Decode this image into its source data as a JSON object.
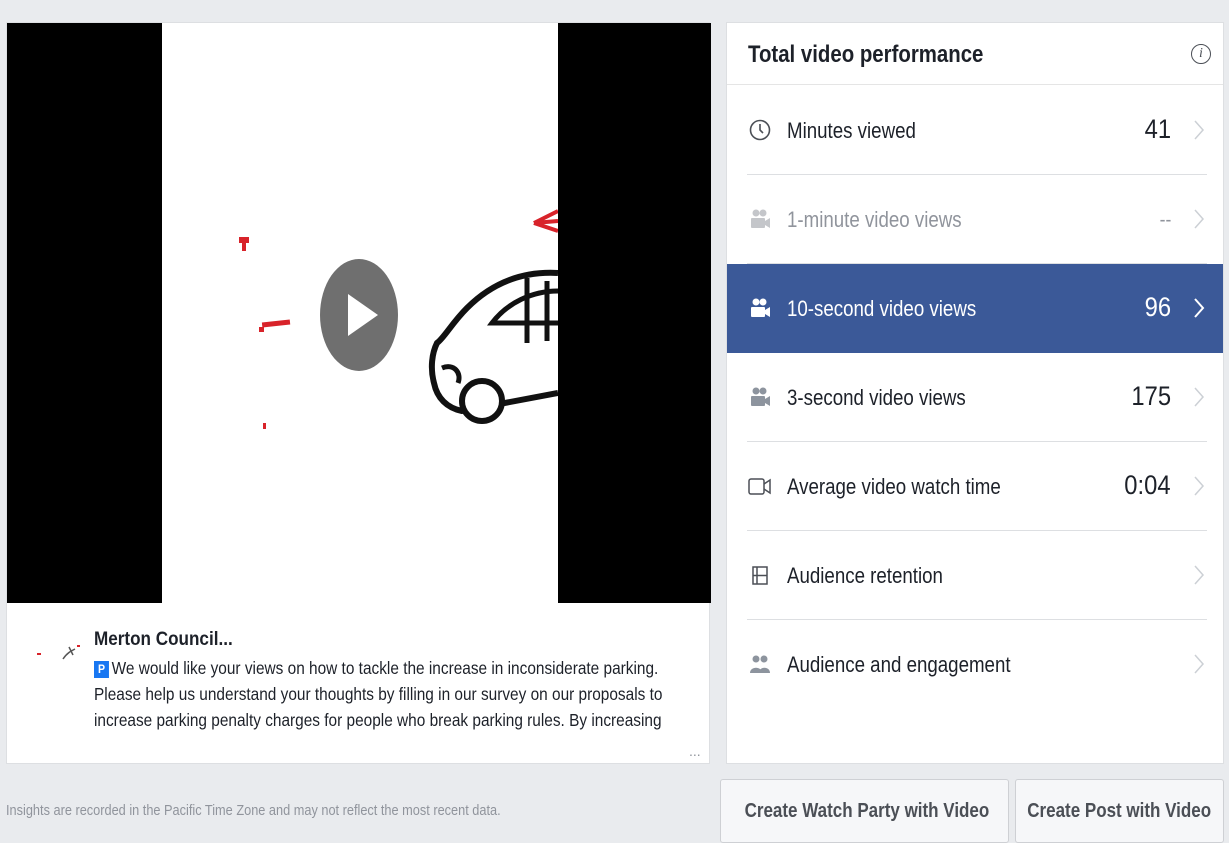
{
  "post": {
    "page_name": "Merton Council...",
    "badge": "P",
    "text": "We would like your views on how to tackle the increase in inconsiderate parking. Please help us understand your thoughts by filling in our survey on our proposals to increase parking penalty charges for people who break parking rules. By increasing",
    "ellipsis": "..."
  },
  "metrics": {
    "title": "Total video performance",
    "info_icon": "i",
    "rows": [
      {
        "label": "Minutes viewed",
        "value": "41",
        "icon": "clock-icon",
        "state": "normal"
      },
      {
        "label": "1-minute video views",
        "value": "--",
        "icon": "camera-icon",
        "state": "muted"
      },
      {
        "label": "10-second video views",
        "value": "96",
        "icon": "camera-icon",
        "state": "active"
      },
      {
        "label": "3-second video views",
        "value": "175",
        "icon": "camera-icon",
        "state": "normal"
      },
      {
        "label": "Average video watch time",
        "value": "0:04",
        "icon": "video-icon",
        "state": "normal"
      },
      {
        "label": "Audience retention",
        "value": "",
        "icon": "film-icon",
        "state": "normal"
      },
      {
        "label": "Audience and engagement",
        "value": "",
        "icon": "people-icon",
        "state": "normal"
      }
    ]
  },
  "footer": {
    "note": "Insights are recorded in the Pacific Time Zone and may not reflect the most recent data.",
    "watch_party_label": "Create Watch Party with Video",
    "create_post_label": "Create Post with Video"
  },
  "colors": {
    "active_row": "#3b5998",
    "accent_red": "#d8232a",
    "badge_blue": "#1877f2"
  }
}
